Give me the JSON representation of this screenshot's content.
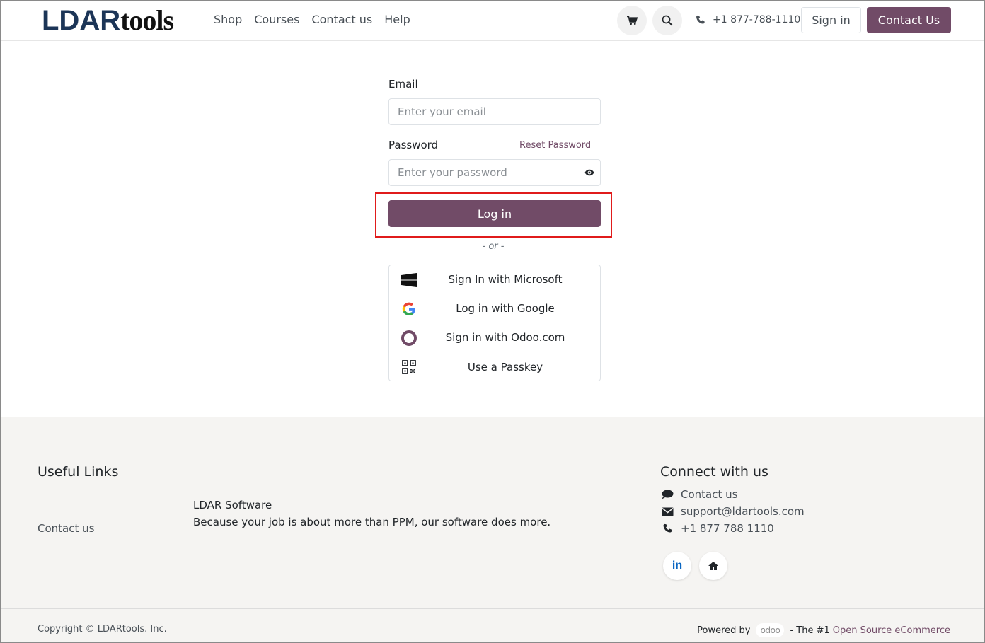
{
  "header": {
    "logo_part1": "LDAR",
    "logo_part2": "tools",
    "nav": [
      "Shop",
      "Courses",
      "Contact us",
      "Help"
    ],
    "phone": "+1 877-788-1110",
    "signin_label": "Sign in",
    "contact_label": "Contact Us"
  },
  "form": {
    "email_label": "Email",
    "email_placeholder": "Enter your email",
    "password_label": "Password",
    "password_placeholder": "Enter your password",
    "reset_label": "Reset Password",
    "login_label": "Log in",
    "or_label": "- or -",
    "oauth": [
      {
        "label": "Sign In with Microsoft",
        "icon": "microsoft-icon"
      },
      {
        "label": "Log in with Google",
        "icon": "google-icon"
      },
      {
        "label": "Sign in with Odoo.com",
        "icon": "odoo-ring-icon"
      },
      {
        "label": "Use a Passkey",
        "icon": "qr-code-icon"
      }
    ]
  },
  "footer": {
    "useful_links_title": "Useful Links",
    "contact_link": "Contact us",
    "about_title": "LDAR Software",
    "about_text": "Because your job is about more than PPM, our software does more.",
    "connect_title": "Connect with us",
    "connect_contact": "Contact us",
    "connect_email": "support@ldartools.com",
    "connect_phone": "+1 877 788 1110",
    "linkedin_label": "in",
    "copyright": "Copyright © LDARtools. Inc.",
    "powered_by": "Powered by",
    "odoo_word": "odoo",
    "tagline_pre": "- The #1",
    "tagline_link": "Open Source eCommerce"
  },
  "colors": {
    "brand": "#714b67",
    "highlight": "#e01b1b",
    "logo_blue": "#1c3557"
  }
}
